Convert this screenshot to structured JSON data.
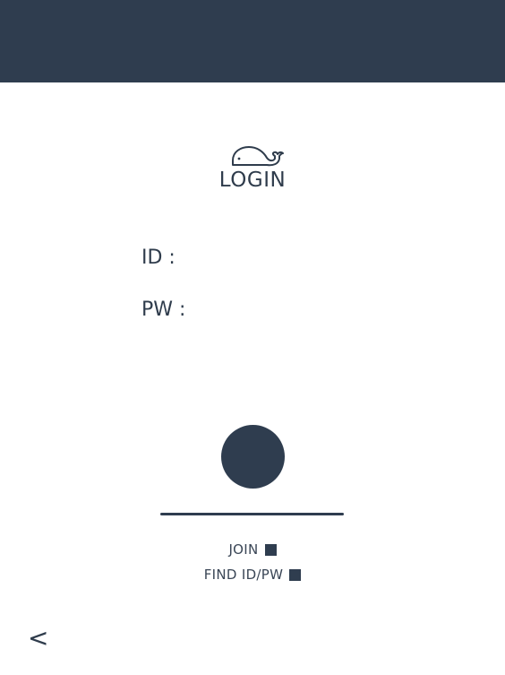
{
  "header": {
    "color": "#2f3d4f"
  },
  "logo": {
    "icon": "whale-icon"
  },
  "title": "LOGIN",
  "form": {
    "id_label": "ID :",
    "id_value": "",
    "pw_label": "PW :",
    "pw_value": ""
  },
  "links": {
    "join": "JOIN",
    "find": "FIND ID/PW"
  },
  "back": "<",
  "colors": {
    "primary": "#2f3d4f",
    "text": "#2f3c4c",
    "background": "#ffffff"
  }
}
